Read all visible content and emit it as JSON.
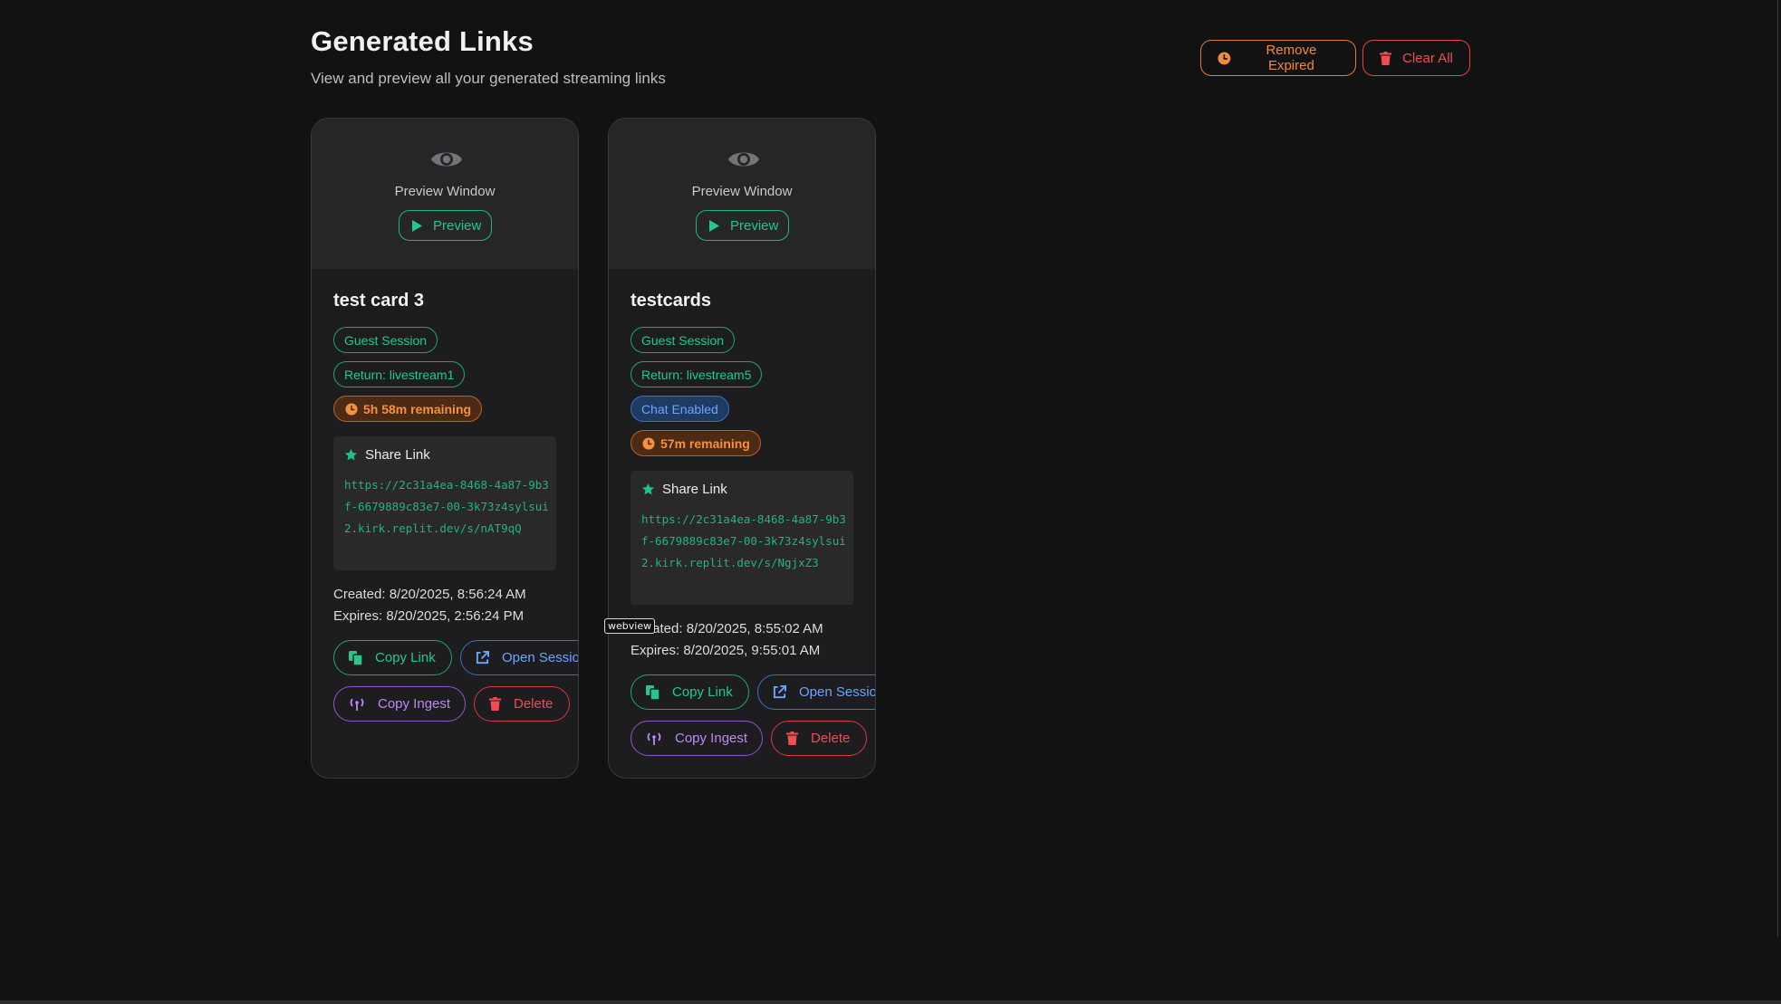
{
  "header": {
    "title": "Generated Links",
    "subtitle": "View and preview all your generated streaming links"
  },
  "toolbar": {
    "remove_expired_label": "Remove Expired",
    "clear_all_label": "Clear All"
  },
  "cards": [
    {
      "preview_label": "Preview Window",
      "preview_button": "Preview",
      "title": "test card 3",
      "badges": {
        "session": "Guest Session",
        "return": "Return: livestream1",
        "remaining": "5h 58m remaining"
      },
      "share_label": "Share Link",
      "share_url": "https://2c31a4ea-8468-4a87-9b3f-6679889c83e7-00-3k73z4sylsui2.kirk.replit.dev/s/nAT9qQ",
      "created": "Created: 8/20/2025, 8:56:24 AM",
      "expires": "Expires: 8/20/2025, 2:56:24 PM",
      "actions": {
        "copy_link": "Copy Link",
        "open_session": "Open Session",
        "copy_ingest": "Copy Ingest",
        "delete": "Delete"
      }
    },
    {
      "preview_label": "Preview Window",
      "preview_button": "Preview",
      "title": "testcards",
      "badges": {
        "session": "Guest Session",
        "return": "Return: livestream5",
        "chat": "Chat Enabled",
        "remaining": "57m remaining"
      },
      "share_label": "Share Link",
      "share_url": "https://2c31a4ea-8468-4a87-9b3f-6679889c83e7-00-3k73z4sylsui2.kirk.replit.dev/s/NgjxZ3",
      "created": "Created: 8/20/2025, 8:55:02 AM",
      "expires": "Expires: 8/20/2025, 9:55:01 AM",
      "actions": {
        "copy_link": "Copy Link",
        "open_session": "Open Session",
        "copy_ingest": "Copy Ingest",
        "delete": "Delete"
      }
    }
  ],
  "tooltip": "webview",
  "colors": {
    "background": "#121212",
    "card": "#1d1d1f",
    "green": "#22c98b",
    "blue": "#6aa5ff",
    "orange": "#f08a3e",
    "red": "#ef4d52",
    "purple": "#bf88f5"
  }
}
